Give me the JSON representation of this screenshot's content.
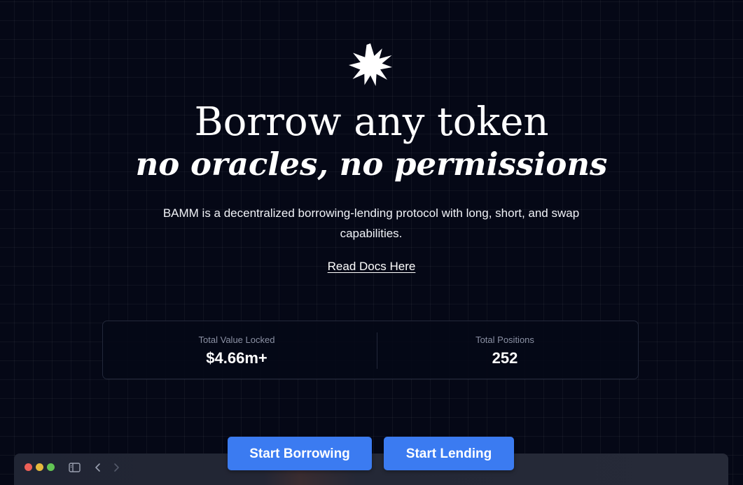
{
  "hero": {
    "logo_icon": "starburst-icon",
    "title": "Borrow any token",
    "subtitle": "no oracles, no permissions",
    "description": "BAMM is a decentralized borrowing-lending protocol with long, short, and swap capabilities.",
    "docs_link": "Read Docs Here"
  },
  "stats": [
    {
      "label": "Total Value Locked",
      "value": "$4.66m+"
    },
    {
      "label": "Total Positions",
      "value": "252"
    }
  ],
  "actions": {
    "borrow_label": "Start Borrowing",
    "lend_label": "Start Lending"
  },
  "browser_bar": {
    "icons": [
      "close-dot-icon",
      "minimize-dot-icon",
      "maximize-dot-icon",
      "sidebar-toggle-icon",
      "back-arrow-icon",
      "forward-arrow-icon"
    ]
  },
  "colors": {
    "background": "#050816",
    "accent": "#3b7bf1",
    "muted_text": "#8b91a4",
    "border": "#23283a"
  }
}
